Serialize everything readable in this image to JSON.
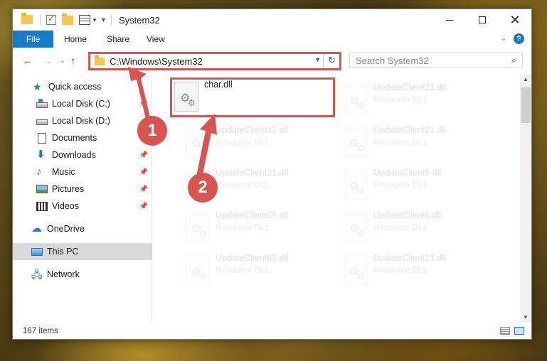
{
  "window": {
    "title": "System32",
    "controls": {
      "minimize": "",
      "maximize": "",
      "close": "✕"
    }
  },
  "ribbon": {
    "tabs": [
      {
        "label": "File"
      },
      {
        "label": "Home"
      },
      {
        "label": "Share"
      },
      {
        "label": "View"
      }
    ],
    "help_label": "?"
  },
  "navigation": {
    "address": "C:\\Windows\\System32",
    "search_placeholder": "Search System32"
  },
  "sidebar": {
    "items": [
      {
        "label": "Quick access",
        "icon": "star-icon"
      },
      {
        "label": "Local Disk (C:)",
        "icon": "disk-icon",
        "pinned": true
      },
      {
        "label": "Local Disk (D:)",
        "icon": "disk-icon",
        "pinned": false
      },
      {
        "label": "Documents",
        "icon": "documents-icon",
        "pinned": true
      },
      {
        "label": "Downloads",
        "icon": "downloads-icon",
        "pinned": true
      },
      {
        "label": "Music",
        "icon": "music-icon",
        "pinned": true
      },
      {
        "label": "Pictures",
        "icon": "pictures-icon",
        "pinned": true
      },
      {
        "label": "Videos",
        "icon": "videos-icon",
        "pinned": true
      },
      {
        "label": "OneDrive",
        "icon": "onedrive-icon"
      },
      {
        "label": "This PC",
        "icon": "this-pc-icon",
        "selected": true
      },
      {
        "label": "Network",
        "icon": "network-icon"
      }
    ]
  },
  "files": [
    {
      "name": "char.dll",
      "type": "",
      "highlighted": true
    },
    {
      "name": "UpdateClient21.dll",
      "type": "Resource DLL"
    },
    {
      "name": "UpdateClient42.dll",
      "type": "Resource DLL"
    },
    {
      "name": "UpdateClient21.dll",
      "type": "Resource DLL"
    },
    {
      "name": "UpdateClient21.dll",
      "type": "Resource DLL"
    },
    {
      "name": "UpdateClient5.dll",
      "type": "Resource DLL"
    },
    {
      "name": "UpdateClient65.dll",
      "type": "Resource DLL"
    },
    {
      "name": "UpdateClient5.dll",
      "type": "Resource DLL"
    },
    {
      "name": "UpdateClient65.dll",
      "type": "Resource DLL"
    },
    {
      "name": "UpdateClient21.dll",
      "type": "Resource DLL"
    }
  ],
  "status": {
    "item_count": "167 items"
  },
  "annotations": [
    {
      "label": "1"
    },
    {
      "label": "2"
    }
  ],
  "colors": {
    "accent": "#1979ca",
    "highlight_outline": "#d9534f",
    "selected_nav": "#d9d9d9"
  }
}
